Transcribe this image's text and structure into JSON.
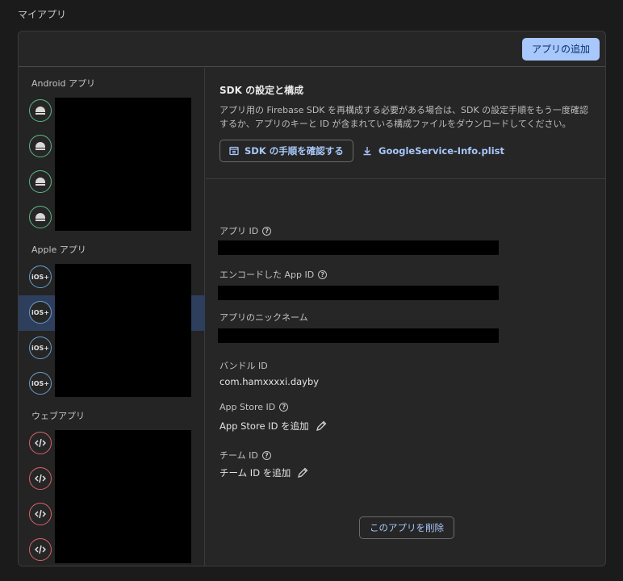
{
  "page": {
    "title": "マイアプリ"
  },
  "header": {
    "add_app_label": "アプリの追加"
  },
  "sidebar": {
    "android_title": "Android アプリ",
    "apple_title": "Apple アプリ",
    "web_title": "ウェブアプリ",
    "ios_badge": "iOS+"
  },
  "sdk": {
    "title": "SDK の設定と構成",
    "description": "アプリ用の Firebase SDK を再構成する必要がある場合は、SDK の設定手順をもう一度確認するか、アプリのキーと ID が含まれている構成ファイルをダウンロードしてください。",
    "steps_button": "SDK の手順を確認する",
    "download_link": "GoogleService-Info.plist"
  },
  "fields": {
    "app_id_label": "アプリ ID",
    "encoded_app_id_label": "エンコードした App ID",
    "nickname_label": "アプリのニックネーム",
    "bundle_id_label": "バンドル ID",
    "bundle_id_value": "com.hamxxxxi.dayby",
    "app_store_id_label": "App Store ID",
    "app_store_id_add": "App Store ID を追加",
    "team_id_label": "チーム ID",
    "team_id_add": "チーム ID を追加"
  },
  "delete_button": "このアプリを削除",
  "colors": {
    "accent": "#a8c7fa",
    "android": "#5bb88a",
    "ios": "#6a9dc9",
    "web": "#d9636b"
  }
}
